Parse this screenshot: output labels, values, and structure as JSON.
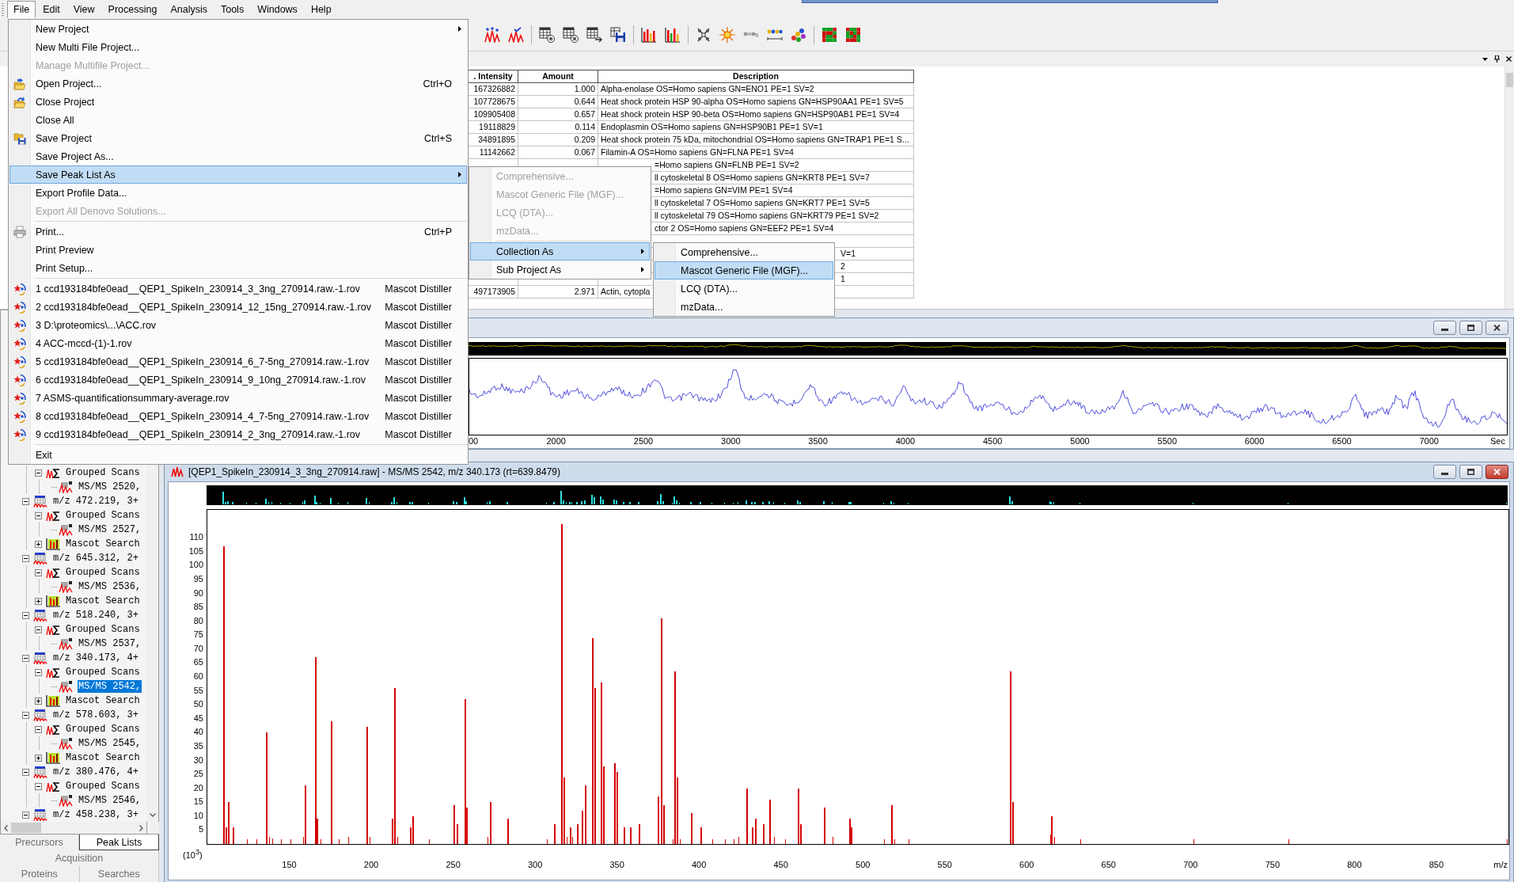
{
  "menu_bar": {
    "items": [
      {
        "label": "File",
        "selected": true
      },
      {
        "label": "Edit",
        "selected": false
      },
      {
        "label": "View",
        "selected": false
      },
      {
        "label": "Processing",
        "selected": false
      },
      {
        "label": "Analysis",
        "selected": false
      },
      {
        "label": "Tools",
        "selected": false
      },
      {
        "label": "Windows",
        "selected": false
      },
      {
        "label": "Help",
        "selected": false
      }
    ]
  },
  "results_table": {
    "columns": [
      ". Intensity",
      "Amount",
      "Description"
    ],
    "rows": [
      {
        "kind": "full",
        "intensity": "167326882",
        "amount": "1.000",
        "description": "Alpha-enolase OS=Homo sapiens GN=ENO1 PE=1 SV=2"
      },
      {
        "kind": "full",
        "intensity": "107728675",
        "amount": "0.644",
        "description": "Heat shock protein HSP 90-alpha OS=Homo sapiens GN=HSP90AA1 PE=1 SV=5"
      },
      {
        "kind": "full",
        "intensity": "109905408",
        "amount": "0.657",
        "description": "Heat shock protein HSP 90-beta OS=Homo sapiens GN=HSP90AB1 PE=1 SV=4"
      },
      {
        "kind": "full",
        "intensity": "19118829",
        "amount": "0.114",
        "description": "Endoplasmin OS=Homo sapiens GN=HSP90B1 PE=1 SV=1"
      },
      {
        "kind": "full",
        "intensity": "34891895",
        "amount": "0.209",
        "description": "Heat shock protein 75 kDa, mitochondrial OS=Homo sapiens GN=TRAP1 PE=1 S..."
      },
      {
        "kind": "full",
        "intensity": "11142662",
        "amount": "0.067",
        "description": "Filamin-A OS=Homo sapiens GN=FLNA PE=1 SV=4"
      },
      {
        "kind": "under_menu",
        "description": "=Homo sapiens GN=FLNB PE=1 SV=2"
      },
      {
        "kind": "under_menu",
        "description": "ll cytoskeletal 8 OS=Homo sapiens GN=KRT8 PE=1 SV=7"
      },
      {
        "kind": "under_menu",
        "description": "=Homo sapiens GN=VIM PE=1 SV=4"
      },
      {
        "kind": "under_menu",
        "description": "ll cytoskeletal 7 OS=Homo sapiens GN=KRT7 PE=1 SV=5"
      },
      {
        "kind": "under_menu",
        "description": "ll cytoskeletal 79 OS=Homo sapiens GN=KRT79 PE=1 SV=2"
      },
      {
        "kind": "under_menu",
        "description": "ctor 2 OS=Homo sapiens GN=EEF2 PE=1 SV=4"
      },
      {
        "kind": "covered"
      },
      {
        "kind": "under_submenu",
        "description": "V=1"
      },
      {
        "kind": "under_submenu",
        "description": "2"
      },
      {
        "kind": "half_covered",
        "description": "1"
      },
      {
        "kind": "full",
        "intensity": "497173905",
        "amount": "2.971",
        "description": "Actin, cytopla"
      }
    ]
  },
  "chromatogram_window": {
    "active": false,
    "axis_labels": [
      "00",
      "2000",
      "2500",
      "3000",
      "3500",
      "4000",
      "4500",
      "5000",
      "5500",
      "6000",
      "6500",
      "7000"
    ],
    "axis_unit": "Sec"
  },
  "tree": {
    "items": [
      {
        "children": [
          {
            "kind": "grouped",
            "label": "Grouped Scans",
            "expanded": true,
            "selected": false,
            "children": [
              {
                "kind": "msms",
                "label": "MS/MS 2520,",
                "selected": false
              }
            ]
          }
        ]
      },
      {
        "kind": "precursor",
        "label": "m/z 472.219, 3+",
        "expanded": true,
        "selected": false,
        "children": [
          {
            "kind": "grouped",
            "label": "Grouped Scans",
            "expanded": true,
            "selected": false,
            "children": [
              {
                "kind": "msms",
                "label": "MS/MS 2527,",
                "selected": false
              }
            ]
          },
          {
            "kind": "search",
            "label": "Mascot Search",
            "expanded": false,
            "selected": false
          }
        ]
      },
      {
        "kind": "precursor",
        "label": "m/z 645.312, 2+",
        "expanded": true,
        "selected": false,
        "children": [
          {
            "kind": "grouped",
            "label": "Grouped Scans",
            "expanded": true,
            "selected": false,
            "children": [
              {
                "kind": "msms",
                "label": "MS/MS 2536,",
                "selected": false
              }
            ]
          },
          {
            "kind": "search",
            "label": "Mascot Search",
            "expanded": false,
            "selected": false
          }
        ]
      },
      {
        "kind": "precursor",
        "label": "m/z 518.240, 3+",
        "expanded": true,
        "selected": false,
        "children": [
          {
            "kind": "grouped",
            "label": "Grouped Scans",
            "expanded": true,
            "selected": false,
            "children": [
              {
                "kind": "msms",
                "label": "MS/MS 2537,",
                "selected": false
              }
            ]
          }
        ]
      },
      {
        "kind": "precursor",
        "label": "m/z 340.173, 4+",
        "expanded": true,
        "selected": false,
        "children": [
          {
            "kind": "grouped",
            "label": "Grouped Scans",
            "expanded": true,
            "selected": false,
            "children": [
              {
                "kind": "msms",
                "label": "MS/MS 2542,",
                "selected": true
              }
            ]
          },
          {
            "kind": "search",
            "label": "Mascot Search",
            "expanded": false,
            "selected": false
          }
        ]
      },
      {
        "kind": "precursor",
        "label": "m/z 578.603, 3+",
        "expanded": true,
        "selected": false,
        "children": [
          {
            "kind": "grouped",
            "label": "Grouped Scans",
            "expanded": true,
            "selected": false,
            "children": [
              {
                "kind": "msms",
                "label": "MS/MS 2545,",
                "selected": false
              }
            ]
          },
          {
            "kind": "search",
            "label": "Mascot Search",
            "expanded": false,
            "selected": false
          }
        ]
      },
      {
        "kind": "precursor",
        "label": "m/z 380.476, 4+",
        "expanded": true,
        "selected": false,
        "children": [
          {
            "kind": "grouped",
            "label": "Grouped Scans",
            "expanded": true,
            "selected": false,
            "children": [
              {
                "kind": "msms",
                "label": "MS/MS 2546,",
                "selected": false
              }
            ]
          }
        ]
      },
      {
        "kind": "precursor",
        "label": "m/z 458.238, 3+",
        "expanded": true,
        "selected": false
      }
    ]
  },
  "panel_tabs": {
    "rows": [
      {
        "tabs": [
          {
            "label": "Precursors",
            "selected": false
          },
          {
            "label": "Peak Lists",
            "selected": true
          }
        ]
      },
      {
        "tabs": [
          {
            "label": "Acquisition",
            "selected": false
          }
        ]
      },
      {
        "tabs": [
          {
            "label": "Proteins",
            "selected": false
          },
          {
            "label": "Searches",
            "selected": false
          }
        ]
      }
    ]
  },
  "spectrum_window": {
    "active": true,
    "title": "[QEP1_SpikeIn_230914_3_3ng_270914.raw] - MS/MS 2542, m/z 340.173 (rt=639.8479)",
    "chart_data": {
      "type": "bar",
      "xlabel": "m/z",
      "ylabel": "(10$^{3}$)",
      "x": [
        110.2,
        111.5,
        112.8,
        115.7,
        136.3,
        160,
        166,
        167.3,
        175.8,
        197.5,
        213.2,
        214.5,
        224.2,
        225.5,
        250.8,
        252.6,
        257.3,
        258.6,
        272.8,
        283.6,
        312.2,
        316.5,
        317.8,
        321.5,
        326.1,
        328.9,
        330.7,
        335.2,
        336.5,
        340.7,
        342,
        348.8,
        350.1,
        354.6,
        358.3,
        363.7,
        375.4,
        377.2,
        378.5,
        385.5,
        386.8,
        395.8,
        401.2,
        429.6,
        432.6,
        434.6,
        439.7,
        443.3,
        461,
        462.3,
        476.9,
        492,
        493.3,
        518,
        590.2,
        591.5,
        615.5
      ],
      "values": [
        107,
        6,
        15,
        6,
        40,
        21,
        67,
        9,
        44,
        42,
        9,
        56,
        6,
        10,
        14,
        7,
        52,
        13,
        15,
        9,
        7,
        115,
        24,
        6,
        7,
        12,
        21,
        74,
        56,
        58,
        28,
        29,
        26,
        6,
        6,
        7,
        17,
        81,
        14,
        62,
        24,
        11,
        6,
        20,
        6,
        9,
        7,
        16,
        20,
        7,
        13,
        9,
        6,
        14,
        62,
        15,
        10
      ],
      "xlim": [
        100,
        894
      ],
      "ylim": [
        0,
        120
      ],
      "xticks": [
        150,
        200,
        250,
        300,
        350,
        400,
        450,
        500,
        550,
        600,
        650,
        700,
        750,
        800,
        850
      ],
      "yticks": [
        5,
        10,
        15,
        20,
        25,
        30,
        35,
        40,
        45,
        50,
        55,
        60,
        65,
        70,
        75,
        80,
        85,
        90,
        95,
        100,
        105,
        110
      ]
    }
  },
  "file_menu": {
    "items": [
      {
        "kind": "plain",
        "label": "New Project",
        "submenu": true,
        "disabled": false,
        "selected": false
      },
      {
        "kind": "plain",
        "label": "New Multi File Project...",
        "submenu": false,
        "disabled": false,
        "selected": false
      },
      {
        "kind": "plain",
        "label": "Manage Multifile Project...",
        "submenu": false,
        "disabled": true,
        "selected": false
      },
      {
        "kind": "open",
        "label": "Open Project...",
        "shortcut": "Ctrl+O",
        "submenu": false,
        "disabled": false,
        "selected": false
      },
      {
        "kind": "close",
        "label": "Close Project",
        "submenu": false,
        "disabled": false,
        "selected": false
      },
      {
        "kind": "plain",
        "label": "Close All",
        "submenu": false,
        "disabled": false,
        "selected": false
      },
      {
        "kind": "save",
        "label": "Save Project",
        "shortcut": "Ctrl+S",
        "submenu": false,
        "disabled": false,
        "selected": false
      },
      {
        "kind": "plain",
        "label": "Save Project As...",
        "submenu": false,
        "disabled": false,
        "selected": false
      },
      {
        "kind": "plain",
        "label": "Save Peak List As",
        "submenu": true,
        "disabled": false,
        "selected": true
      },
      {
        "kind": "plain",
        "label": "Export Profile Data...",
        "submenu": false,
        "disabled": false,
        "selected": false
      },
      {
        "kind": "plain",
        "label": "Export All Denovo Solutions...",
        "submenu": false,
        "disabled": true,
        "selected": false
      },
      {
        "kind": "separator"
      },
      {
        "kind": "print",
        "label": "Print...",
        "shortcut": "Ctrl+P",
        "submenu": false,
        "disabled": false,
        "selected": false
      },
      {
        "kind": "plain",
        "label": "Print Preview",
        "submenu": false,
        "disabled": false,
        "selected": false
      },
      {
        "kind": "plain",
        "label": "Print Setup...",
        "submenu": false,
        "disabled": false,
        "selected": false
      },
      {
        "kind": "separator"
      },
      {
        "kind": "recent",
        "label": "1 ccd193184bfe0ead__QEP1_SpikeIn_230914_3_3ng_270914.raw.-1.rov",
        "detail": "Mascot Distiller",
        "submenu": false,
        "disabled": false,
        "selected": false
      },
      {
        "kind": "recent",
        "label": "2 ccd193184bfe0ead__QEP1_SpikeIn_230914_12_15ng_270914.raw.-1.rov",
        "detail": "Mascot Distiller",
        "submenu": false,
        "disabled": false,
        "selected": false
      },
      {
        "kind": "recent",
        "label": "3 D:\\proteomics\\...\\ACC.rov",
        "detail": "Mascot Distiller",
        "submenu": false,
        "disabled": false,
        "selected": false
      },
      {
        "kind": "recent",
        "label": "4 ACC-mccd-(1)-1.rov",
        "detail": "Mascot Distiller",
        "submenu": false,
        "disabled": false,
        "selected": false
      },
      {
        "kind": "recent",
        "label": "5 ccd193184bfe0ead__QEP1_SpikeIn_230914_6_7-5ng_270914.raw.-1.rov",
        "detail": "Mascot Distiller",
        "submenu": false,
        "disabled": false,
        "selected": false
      },
      {
        "kind": "recent",
        "label": "6 ccd193184bfe0ead__QEP1_SpikeIn_230914_9_10ng_270914.raw.-1.rov",
        "detail": "Mascot Distiller",
        "submenu": false,
        "disabled": false,
        "selected": false
      },
      {
        "kind": "recent",
        "label": "7 ASMS-quantificationsummary-average.rov",
        "detail": "Mascot Distiller",
        "submenu": false,
        "disabled": false,
        "selected": false
      },
      {
        "kind": "recent",
        "label": "8 ccd193184bfe0ead__QEP1_SpikeIn_230914_4_7-5ng_270914.raw.-1.rov",
        "detail": "Mascot Distiller",
        "submenu": false,
        "disabled": false,
        "selected": false
      },
      {
        "kind": "recent",
        "label": "9 ccd193184bfe0ead__QEP1_SpikeIn_230914_2_3ng_270914.raw.-1.rov",
        "detail": "Mascot Distiller",
        "submenu": false,
        "disabled": false,
        "selected": false
      },
      {
        "kind": "separator"
      },
      {
        "kind": "plain",
        "label": "Exit",
        "submenu": false,
        "disabled": false,
        "selected": false
      }
    ]
  },
  "save_peak_list_submenu": {
    "items": [
      {
        "kind": "plain",
        "label": "Comprehensive...",
        "submenu": false,
        "disabled": true,
        "selected": false
      },
      {
        "kind": "plain",
        "label": "Mascot Generic File (MGF)...",
        "submenu": false,
        "disabled": true,
        "selected": false
      },
      {
        "kind": "plain",
        "label": "LCQ (DTA)...",
        "submenu": false,
        "disabled": true,
        "selected": false
      },
      {
        "kind": "plain",
        "label": "mzData...",
        "submenu": false,
        "disabled": true,
        "selected": false
      },
      {
        "kind": "separator"
      },
      {
        "kind": "plain",
        "label": "Collection As",
        "submenu": true,
        "disabled": false,
        "selected": true
      },
      {
        "kind": "plain",
        "label": "Sub Project As",
        "submenu": true,
        "disabled": false,
        "selected": false
      }
    ]
  },
  "collection_submenu": {
    "items": [
      {
        "kind": "plain",
        "label": "Comprehensive...",
        "submenu": false,
        "disabled": false,
        "selected": false
      },
      {
        "kind": "plain",
        "label": "Mascot Generic File (MGF)...",
        "submenu": false,
        "disabled": false,
        "selected": true
      },
      {
        "kind": "plain",
        "label": "LCQ (DTA)...",
        "submenu": false,
        "disabled": false,
        "selected": false
      },
      {
        "kind": "plain",
        "label": "mzData...",
        "submenu": false,
        "disabled": false,
        "selected": false
      }
    ]
  }
}
